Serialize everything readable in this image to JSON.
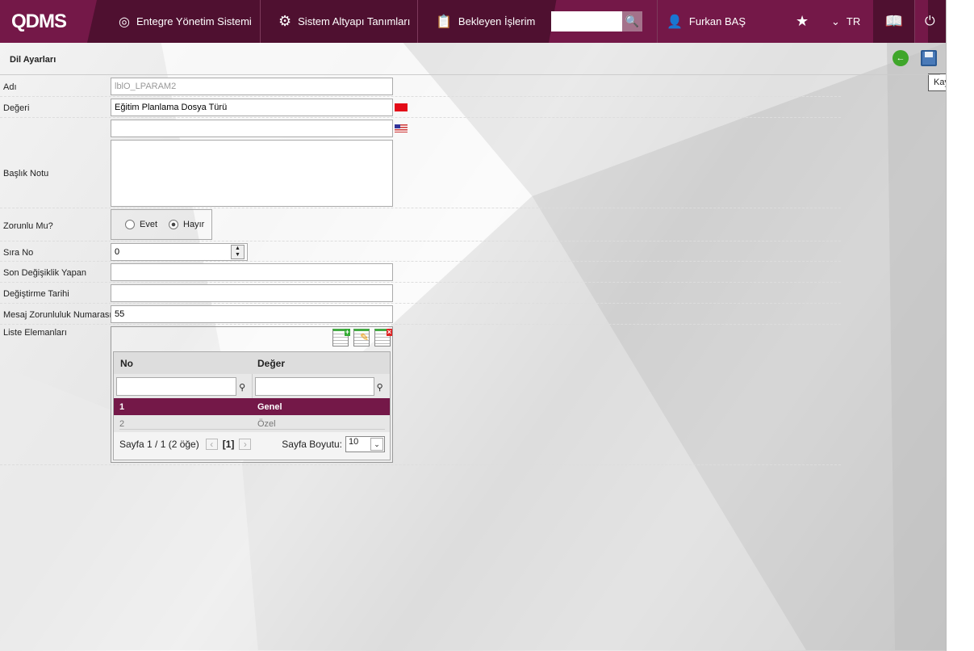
{
  "header": {
    "logo": "QDMS",
    "nav": [
      "Entegre Yönetim Sistemi",
      "Sistem Altyapı Tanımları",
      "Bekleyen İşlerim"
    ],
    "search_placeholder": "",
    "user": "Furkan BAŞ",
    "lang": "TR"
  },
  "page": {
    "title": "Dil Ayarları",
    "save_tooltip": "Kaydet"
  },
  "form": {
    "adi_label": "Adı",
    "adi_value": "lblO_LPARAM2",
    "degeri_label": "Değeri",
    "degeri_tr": "Eğitim Planlama Dosya Türü",
    "degeri_en": "",
    "baslik_label": "Başlık Notu",
    "baslik_value": "",
    "zorunlu_label": "Zorunlu Mu?",
    "evet": "Evet",
    "hayir": "Hayır",
    "sira_label": "Sıra No",
    "sira_value": "0",
    "son_label": "Son Değişiklik Yapan",
    "son_value": "",
    "tarih_label": "Değiştirme Tarihi",
    "tarih_value": "",
    "mesaj_label": "Mesaj Zorunluluk Numarası",
    "mesaj_value": "55",
    "liste_label": "Liste Elemanları"
  },
  "grid": {
    "columns": [
      "No",
      "Değer"
    ],
    "rows": [
      {
        "no": "1",
        "deger": "Genel"
      },
      {
        "no": "2",
        "deger": "Özel"
      }
    ],
    "pager_text": "Sayfa 1 / 1 (2 öğe)",
    "current_page": "[1]",
    "page_size_label": "Sayfa Boyutu:",
    "page_size": "10"
  },
  "colors": {
    "brand": "#741848",
    "brand_dark": "#4f1030"
  }
}
